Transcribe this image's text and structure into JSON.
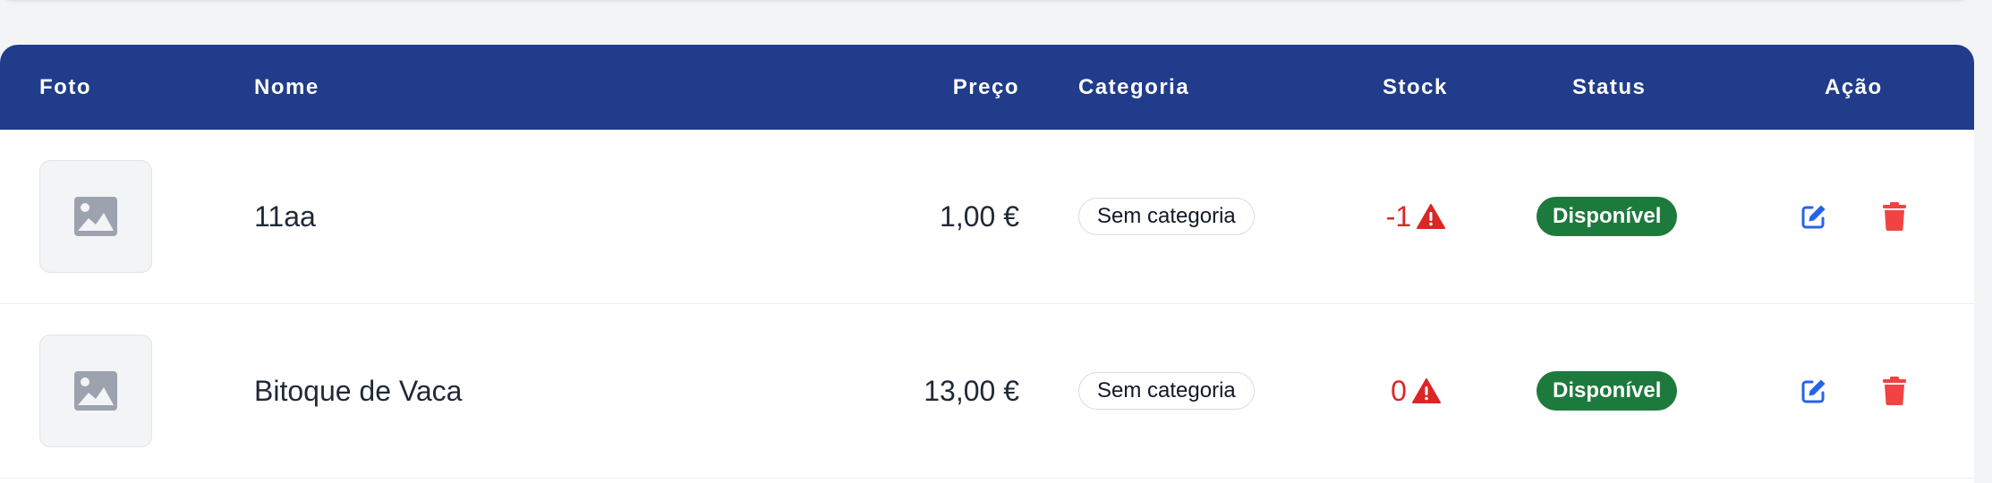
{
  "table": {
    "headers": {
      "photo": "Foto",
      "name": "Nome",
      "price": "Preço",
      "category": "Categoria",
      "stock": "Stock",
      "status": "Status",
      "action": "Ação"
    },
    "rows": [
      {
        "name": "11aa",
        "price": "1,00 €",
        "category": "Sem categoria",
        "stock": "-1",
        "stock_warning": true,
        "status": "Disponível"
      },
      {
        "name": "Bitoque de Vaca",
        "price": "13,00 €",
        "category": "Sem categoria",
        "stock": "0",
        "stock_warning": true,
        "status": "Disponível"
      }
    ]
  },
  "icons": {
    "photo_placeholder": "image-icon",
    "stock_warning": "warning-triangle-icon",
    "edit": "edit-icon",
    "delete": "trash-icon"
  },
  "colors": {
    "header_bg": "#213c8a",
    "status_available": "#1d7a3d",
    "stock_negative": "#dc2626",
    "edit_icon": "#2563eb",
    "delete_icon": "#ef4444"
  }
}
